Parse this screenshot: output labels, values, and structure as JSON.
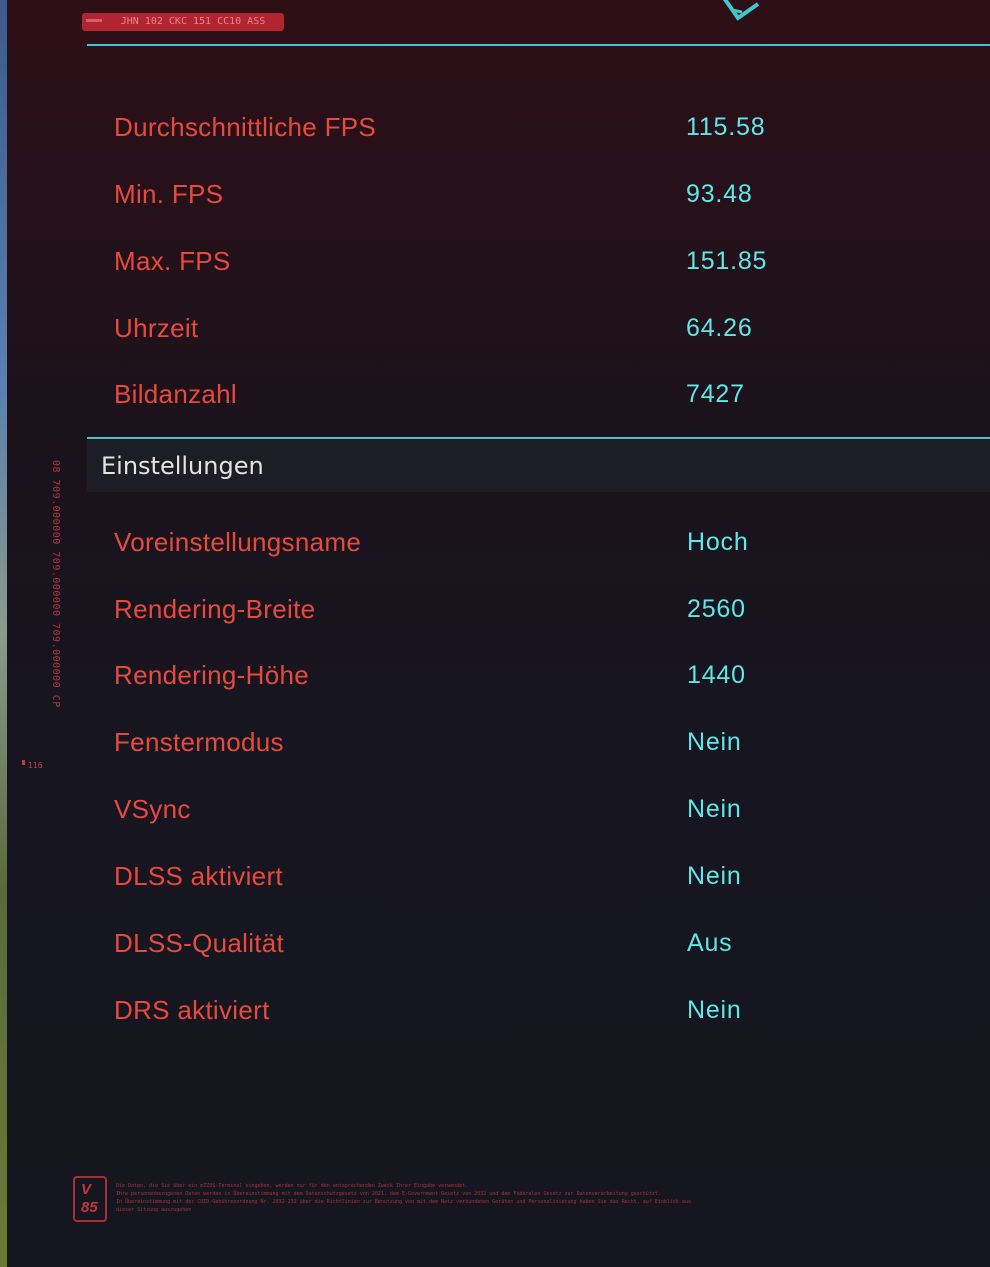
{
  "header": {
    "tag_text": "JHN 102 CKC 151 CC10 ASS"
  },
  "stats": [
    {
      "label": "Durchschnittliche FPS",
      "value": "115.58"
    },
    {
      "label": "Min. FPS",
      "value": "93.48"
    },
    {
      "label": "Max. FPS",
      "value": "151.85"
    },
    {
      "label": "Uhrzeit",
      "value": "64.26"
    },
    {
      "label": "Bildanzahl",
      "value": "7427"
    }
  ],
  "settings": {
    "title": "Einstellungen",
    "rows": [
      {
        "label": "Voreinstellungsname",
        "value": "Hoch"
      },
      {
        "label": "Rendering-Breite",
        "value": "2560"
      },
      {
        "label": "Rendering-Höhe",
        "value": "1440"
      },
      {
        "label": "Fenstermodus",
        "value": "Nein"
      },
      {
        "label": "VSync",
        "value": "Nein"
      },
      {
        "label": "DLSS aktiviert",
        "value": "Nein"
      },
      {
        "label": "DLSS-Qualität",
        "value": "Aus"
      },
      {
        "label": "DRS aktiviert",
        "value": "Nein"
      }
    ]
  },
  "side": {
    "code": "08 709.000000 709.000000 709.000000 CP",
    "num": "116"
  },
  "footer": {
    "badge_line1": "V",
    "badge_line2": "85",
    "lines": [
      "Die Daten, die Sie über ein mZZOS-Terminal eingeben, werden nur für den entsprechenden Zweck Ihrer Eingabe verwendet.",
      "Ihre personenbezogenen Daten werden in Übereinstimmung mit dem Datenschutzgesetz von 2021, dem E-Government-Gesetz von 2032 und dem Föderalen Gesetz zur Datenverarbeitung geschützt.",
      "In Übereinstimmung mit der CUID-Gebührenordnung Nr. 2032-232 über die Richtlinien zur Benutzung von mit dem Netz verbundenen Geräten und Personalisierung haben Sie das Recht, auf Einblick aus",
      "dieser Sitzung auszugehen"
    ]
  },
  "colors": {
    "label": "#e8493d",
    "value": "#5fe6e6",
    "accent": "#3fc6cf"
  }
}
